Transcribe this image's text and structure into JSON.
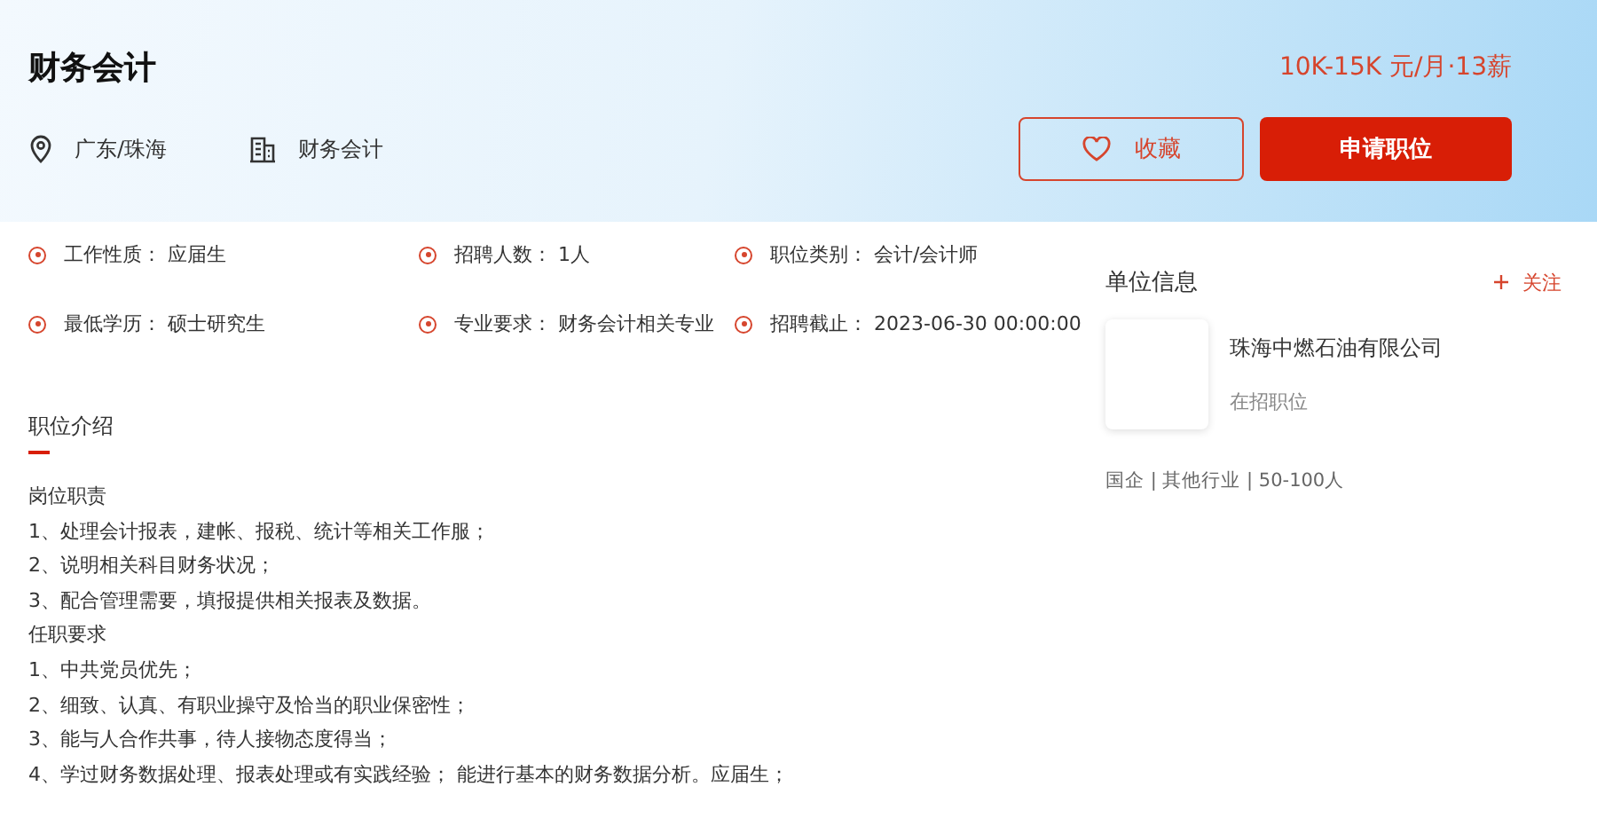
{
  "job": {
    "title": "财务会计",
    "salary": "10K-15K 元/月·13薪",
    "location": "广东/珠海",
    "category": "财务会计"
  },
  "actions": [
    {
      "kind": "favorite",
      "label": "收藏"
    },
    {
      "kind": "apply",
      "label": "申请职位"
    }
  ],
  "facts": [
    {
      "label": "工作性质：",
      "value": "应届生"
    },
    {
      "label": "招聘人数：",
      "value": "1人"
    },
    {
      "label": "职位类别：",
      "value": "会计/会计师"
    },
    {
      "label": "最低学历：",
      "value": "硕士研究生"
    },
    {
      "label": "专业要求：",
      "value": "财务会计相关专业"
    },
    {
      "label": "招聘截止：",
      "value": "2023-06-30 00:00:00"
    }
  ],
  "description": {
    "tab": "职位介绍",
    "sections": [
      {
        "heading": "岗位职责",
        "lines": [
          "1、处理会计报表，建帐、报税、统计等相关工作服；",
          "2、说明相关科目财务状况；",
          "3、配合管理需要，填报提供相关报表及数据。"
        ]
      },
      {
        "heading": "任职要求",
        "lines": [
          "1、中共党员优先；",
          "2、细致、认真、有职业操守及恰当的职业保密性；",
          "3、能与人合作共事，待人接物态度得当；",
          "4、学过财务数据处理、报表处理或有实践经验； 能进行基本的财务数据分析。应届生；"
        ]
      }
    ]
  },
  "company": {
    "heading": "单位信息",
    "follow": "关注",
    "name": "珠海中燃石油有限公司",
    "jobs_link": "在招职位",
    "meta": "国企 | 其他行业 | 50-100人"
  }
}
